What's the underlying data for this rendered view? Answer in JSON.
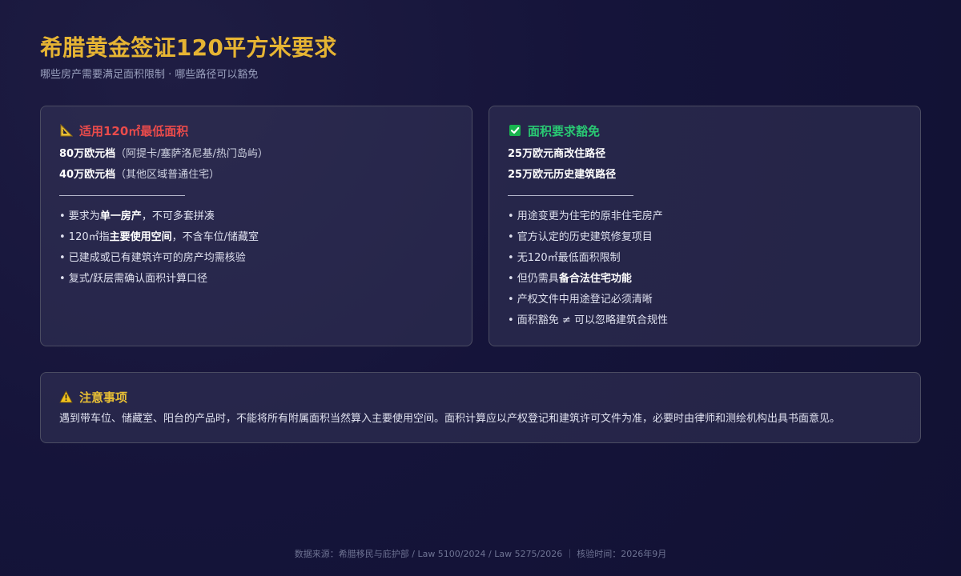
{
  "header": {
    "title": "希腊黄金签证120平方米要求",
    "subtitle": "哪些房产需要满足面积限制 · 哪些路径可以豁免"
  },
  "left_card": {
    "icon": "triangle-ruler-icon",
    "title": "适用120㎡最低面积",
    "tiers": [
      {
        "strong": "80万欧元档",
        "rest": "（阿提卡/塞萨洛尼基/热门岛屿）"
      },
      {
        "strong": "40万欧元档",
        "rest": "（其他区域普通住宅）"
      }
    ],
    "bullets": [
      {
        "before": "• 要求为",
        "strong": "单一房产",
        "after": "，不可多套拼凑"
      },
      {
        "before": "• 120㎡指",
        "strong": "主要使用空间",
        "after": "，不含车位/储藏室"
      },
      {
        "before": "• 已建成或已有建筑许可的房产均需核验",
        "strong": "",
        "after": ""
      },
      {
        "before": "• 复式/跃层需确认面积计算口径",
        "strong": "",
        "after": ""
      }
    ]
  },
  "right_card": {
    "icon": "check-mark-icon",
    "title": "面积要求豁免",
    "paths": [
      "25万欧元商改住路径",
      "25万欧元历史建筑路径"
    ],
    "bullets": [
      {
        "before": "• 用途变更为住宅的原非住宅房产",
        "strong": "",
        "after": ""
      },
      {
        "before": "• 官方认定的历史建筑修复项目",
        "strong": "",
        "after": ""
      },
      {
        "before": "• 无120㎡最低面积限制",
        "strong": "",
        "after": ""
      },
      {
        "before": "• 但仍需具",
        "strong": "备合法住宅功能",
        "after": ""
      },
      {
        "before": "• 产权文件中用途登记必须清晰",
        "strong": "",
        "after": ""
      },
      {
        "before": "• 面积豁免 ≠ 可以忽略建筑合规性",
        "strong": "",
        "after": ""
      }
    ]
  },
  "note_card": {
    "icon": "warning-icon",
    "title": "注意事项",
    "text": "遇到带车位、储藏室、阳台的产品时，不能将所有附属面积当然算入主要使用空间。面积计算应以产权登记和建筑许可文件为准，必要时由律师和测绘机构出具书面意见。"
  },
  "footer": {
    "text": "数据来源：希腊移民与庇护部 / Law 5100/2024 / Law 5275/2026 ｜ 核验时间：2026年9月"
  },
  "colors": {
    "title": "#e6b433",
    "left_heading": "#ea4b4b",
    "right_heading": "#29c873",
    "note_heading": "#e8bf35",
    "background": "#15143a"
  }
}
